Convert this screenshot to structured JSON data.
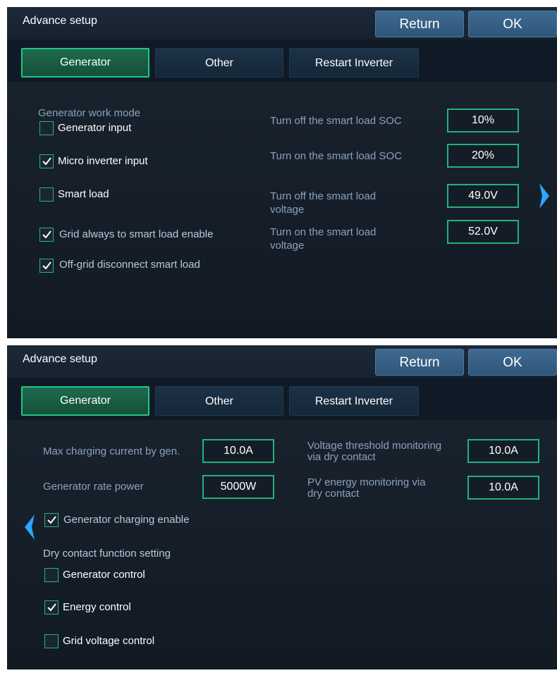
{
  "colors": {
    "accent_green": "#22b27a",
    "panel_bg": "#141d28",
    "button_blue": "#345d82",
    "chevron": "#2aa6ff"
  },
  "screens": [
    {
      "title": "Advance setup",
      "return_label": "Return",
      "ok_label": "OK",
      "tabs": [
        "Generator",
        "Other",
        "Restart Inverter"
      ],
      "active_tab": "Generator",
      "section_label": "Generator work mode",
      "checkboxes": [
        {
          "label": "Generator input",
          "checked": false
        },
        {
          "label": "Micro inverter input",
          "checked": true
        },
        {
          "label": "Smart load",
          "checked": false
        },
        {
          "label": "Grid always to smart load enable",
          "checked": true
        },
        {
          "label": "Off-grid disconnect smart load",
          "checked": true
        }
      ],
      "fields": [
        {
          "label": "Turn off the smart load SOC",
          "value": "10%"
        },
        {
          "label": "Turn on the smart load SOC",
          "value": "20%"
        },
        {
          "label_line1": "Turn off the smart load",
          "label_line2": "voltage",
          "value": "49.0V"
        },
        {
          "label_line1": "Turn on the smart load",
          "label_line2": "voltage",
          "value": "52.0V"
        }
      ],
      "nav_icon": "chevron-right-icon"
    },
    {
      "title": "Advance setup",
      "return_label": "Return",
      "ok_label": "OK",
      "tabs": [
        "Generator",
        "Other",
        "Restart Inverter"
      ],
      "active_tab": "Generator",
      "fields_left": [
        {
          "label": "Max charging current by gen.",
          "value": "10.0A"
        },
        {
          "label": "Generator rate power",
          "value": "5000W"
        }
      ],
      "fields_right": [
        {
          "label_line1": "Voltage threshold monitoring",
          "label_line2": "via dry contact",
          "value": "10.0A"
        },
        {
          "label_line1": "PV energy monitoring via",
          "label_line2": "dry contact",
          "value": "10.0A"
        }
      ],
      "charging_enable": {
        "label": "Generator charging enable",
        "checked": true
      },
      "section_label": "Dry contact function setting",
      "checkboxes": [
        {
          "label": "Generator control",
          "checked": false
        },
        {
          "label": "Energy control",
          "checked": true
        },
        {
          "label": "Grid voltage control",
          "checked": false
        }
      ],
      "nav_icon": "chevron-left-icon"
    }
  ]
}
